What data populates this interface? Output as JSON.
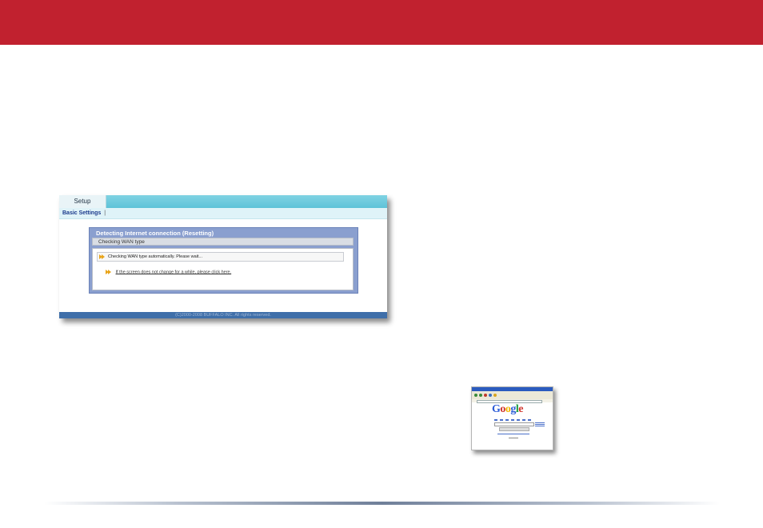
{
  "router_ui": {
    "tab_label": "Setup",
    "subnav_item": "Basic Settings",
    "subnav_separator": "|",
    "panel_title": "Detecting Internet connection (Resetting)",
    "panel_subtitle": "Checking WAN type",
    "status_message": "Checking WAN type automatically. Please wait...",
    "help_link": "If the screen does not change for a while, please click here.",
    "footer_text": "(C)2000-2008 BUFFALO INC. All rights reserved."
  },
  "browser_thumbnail": {
    "logo_letters": [
      "G",
      "o",
      "o",
      "g",
      "l",
      "e"
    ]
  }
}
